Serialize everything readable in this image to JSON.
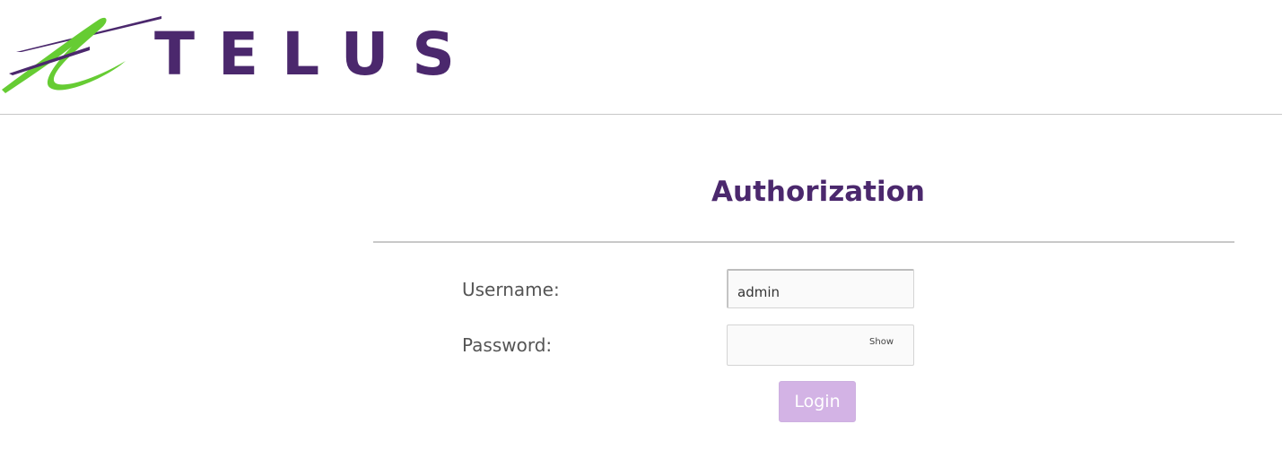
{
  "brand": {
    "name": "TELUS",
    "primary_color": "#4b286d",
    "accent_color": "#66cc33"
  },
  "page": {
    "title": "Authorization"
  },
  "form": {
    "username_label": "Username:",
    "username_value": "admin",
    "password_label": "Password:",
    "password_value": "",
    "show_label": "Show",
    "login_label": "Login",
    "login_button_color": "#d3b3e5"
  }
}
